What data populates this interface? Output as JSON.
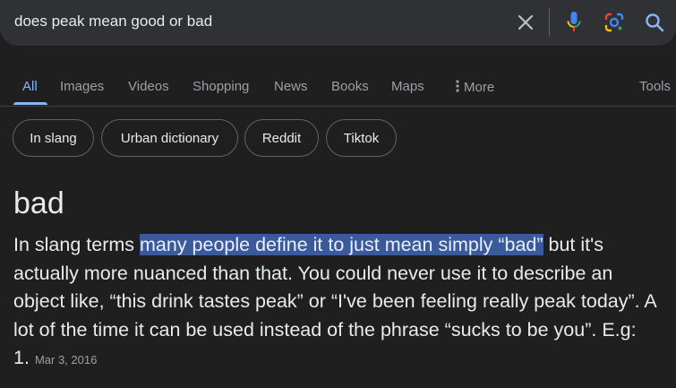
{
  "search": {
    "query": "does peak mean good or bad"
  },
  "icons": {
    "clear": "close-icon",
    "mic": "microphone-icon",
    "lens": "google-lens-icon",
    "search": "search-icon"
  },
  "tabs": [
    {
      "label": "All",
      "active": true
    },
    {
      "label": "Images"
    },
    {
      "label": "Videos"
    },
    {
      "label": "Shopping"
    },
    {
      "label": "News"
    },
    {
      "label": "Books"
    },
    {
      "label": "Maps"
    },
    {
      "label": "More"
    },
    {
      "label": "Tools"
    }
  ],
  "chips": [
    "In slang",
    "Urban dictionary",
    "Reddit",
    "Tiktok"
  ],
  "answer": {
    "title": "bad",
    "text_before": "In slang terms ",
    "highlight": "many people define it to just mean simply “bad”",
    "text_after": " but it's actually more nuanced than that. You could never use it to describe an object like, “this drink tastes peak” or “I've been feeling really peak today”. A lot of the time it can be used instead of the phrase “sucks to be you”. E.g: 1.",
    "date": "Mar 3, 2016"
  },
  "colors": {
    "background": "#1f1f1f",
    "searchbar": "#303134",
    "accent": "#8ab4f8",
    "highlight": "#3b5a9c"
  }
}
